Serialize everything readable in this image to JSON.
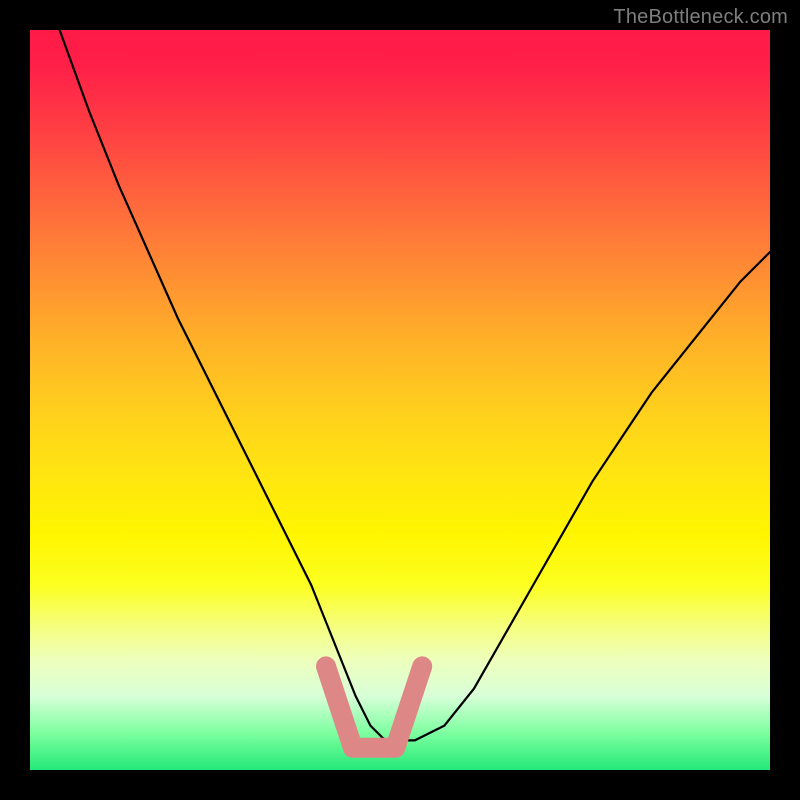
{
  "watermark": "TheBottleneck.com",
  "chart_data": {
    "type": "line",
    "title": "",
    "xlabel": "",
    "ylabel": "",
    "xlim": [
      0,
      100
    ],
    "ylim": [
      0,
      100
    ],
    "series": [
      {
        "name": "curve",
        "color": "#000000",
        "x": [
          4,
          8,
          12,
          16,
          20,
          24,
          28,
          32,
          34,
          36,
          38,
          40,
          42,
          44,
          46,
          48,
          52,
          56,
          60,
          64,
          68,
          72,
          76,
          80,
          84,
          88,
          92,
          96,
          100
        ],
        "values": [
          100,
          89,
          79,
          70,
          61,
          53,
          45,
          37,
          33,
          29,
          25,
          20,
          15,
          10,
          6,
          4,
          4,
          6,
          11,
          18,
          25,
          32,
          39,
          45,
          51,
          56,
          61,
          66,
          70
        ]
      }
    ],
    "highlight": {
      "name": "highlight-band",
      "color": "#de8787",
      "x_range": [
        40,
        53
      ],
      "y_range": [
        3,
        14
      ]
    }
  }
}
